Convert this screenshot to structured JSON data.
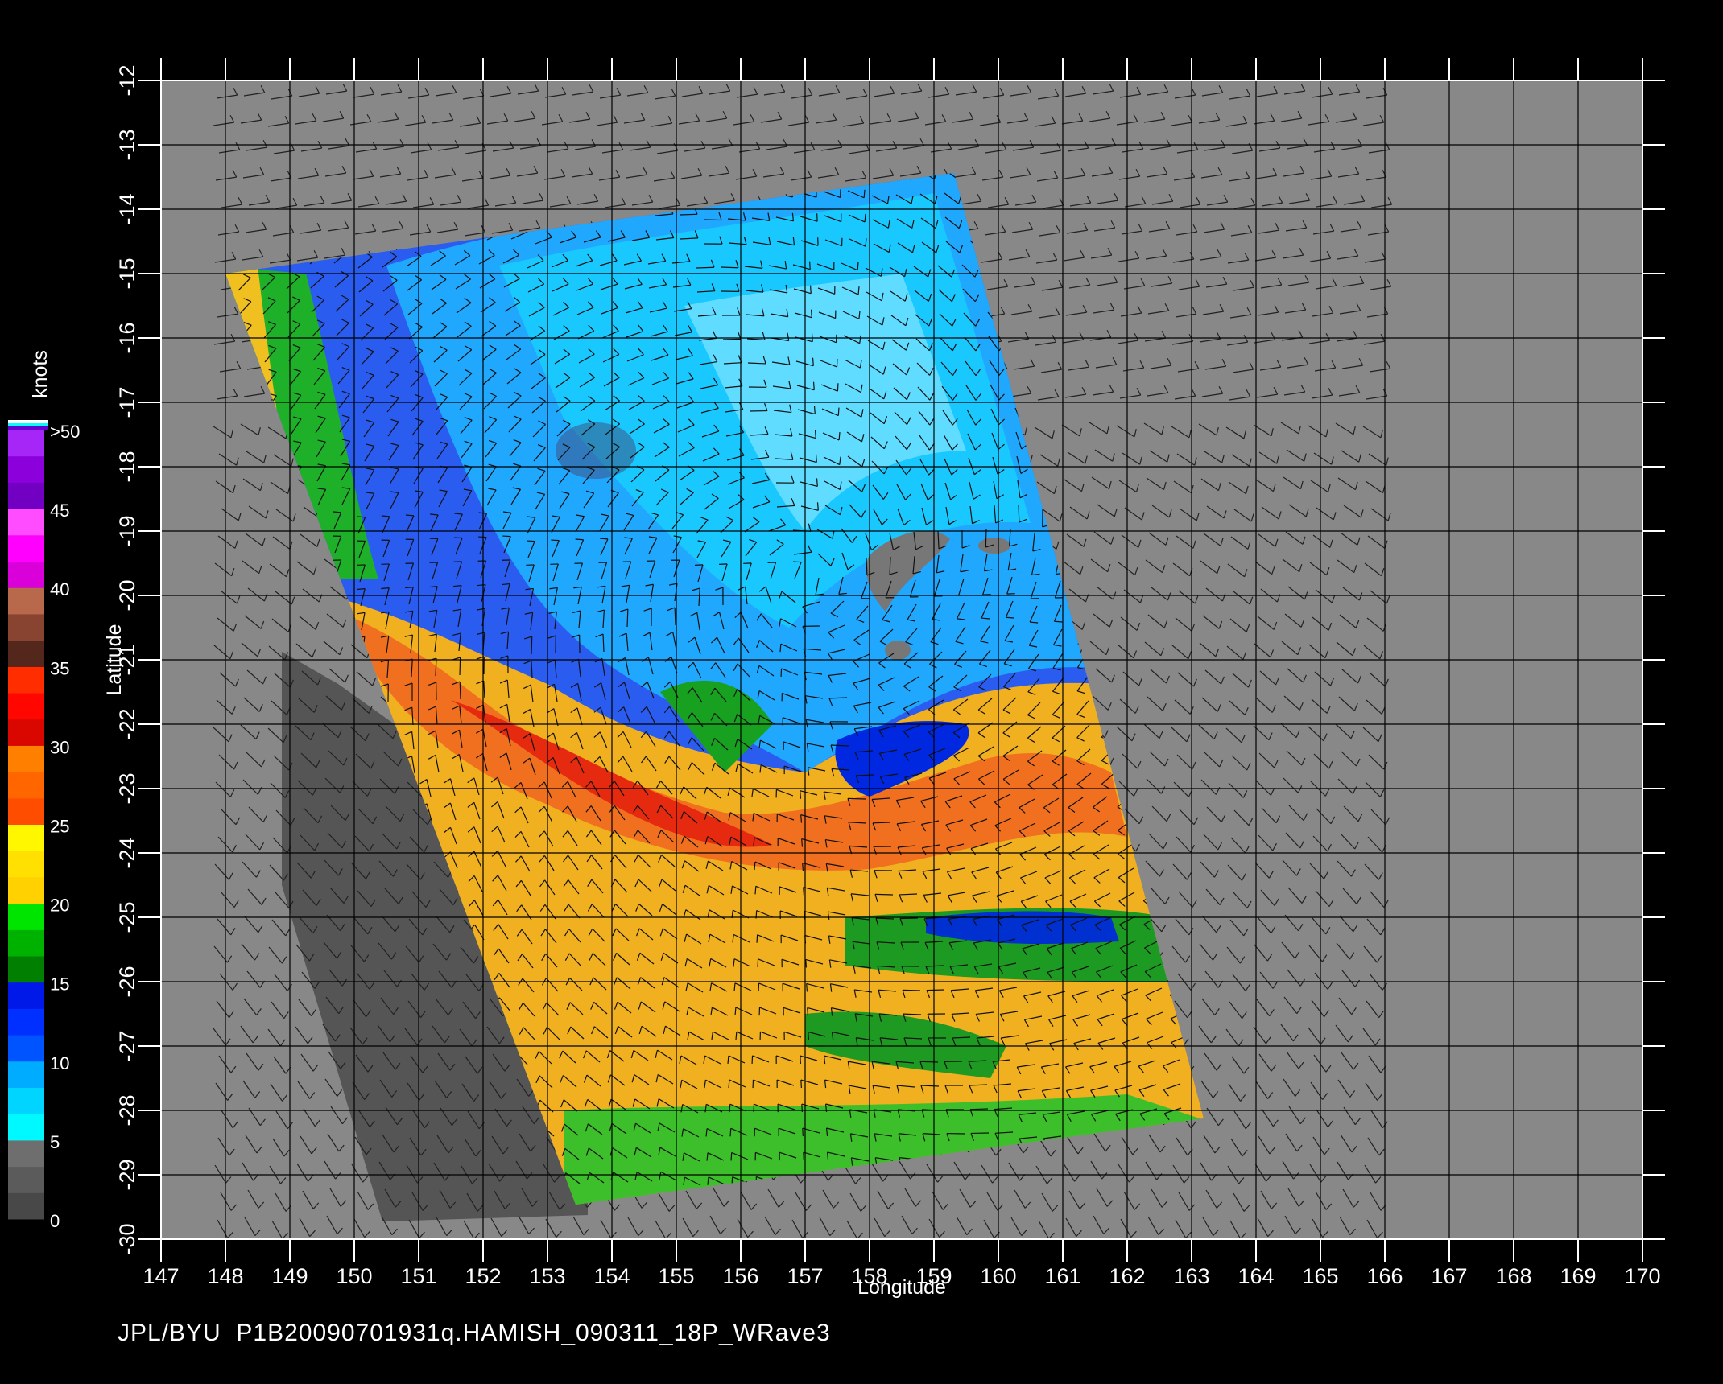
{
  "map": {
    "xlabel": "Longitude",
    "ylabel": "Latitude",
    "lon_ticks": [
      "147",
      "148",
      "149",
      "150",
      "151",
      "152",
      "153",
      "154",
      "155",
      "156",
      "157",
      "158",
      "159",
      "160",
      "161",
      "162",
      "163",
      "164",
      "165",
      "166",
      "167",
      "168",
      "169",
      "170"
    ],
    "lat_ticks": [
      "-12",
      "-13",
      "-14",
      "-15",
      "-16",
      "-17",
      "-18",
      "-19",
      "-20",
      "-21",
      "-22",
      "-23",
      "-24",
      "-25",
      "-26",
      "-27",
      "-28",
      "-29",
      "-30"
    ],
    "lon_range": [
      147,
      170
    ],
    "lat_range": [
      -30,
      -12
    ],
    "grid": true
  },
  "colorbar": {
    "unit_label": "knots",
    "labels": [
      ">50",
      "45",
      "40",
      "35",
      "30",
      "25",
      "20",
      "15",
      "10",
      "5",
      "0"
    ],
    "colors": {
      "0-5": "#555555",
      "5-10": "#00e8ff",
      "10-15": "#0030ff",
      "15-20": "#00cc00",
      "20-25": "#ffe000",
      "25-30": "#ff6600",
      "30-35": "#ff1a00",
      "35-40": "#a0503c",
      "40-45": "#ff00ff",
      "45-50": "#9900dd"
    }
  },
  "footer": {
    "text": "JPL/BYU  P1B20090701931q.HAMISH_090311_18P_WRave3"
  },
  "colors": {
    "background": "#000000",
    "no_data": "#888888",
    "land": "#555555"
  }
}
